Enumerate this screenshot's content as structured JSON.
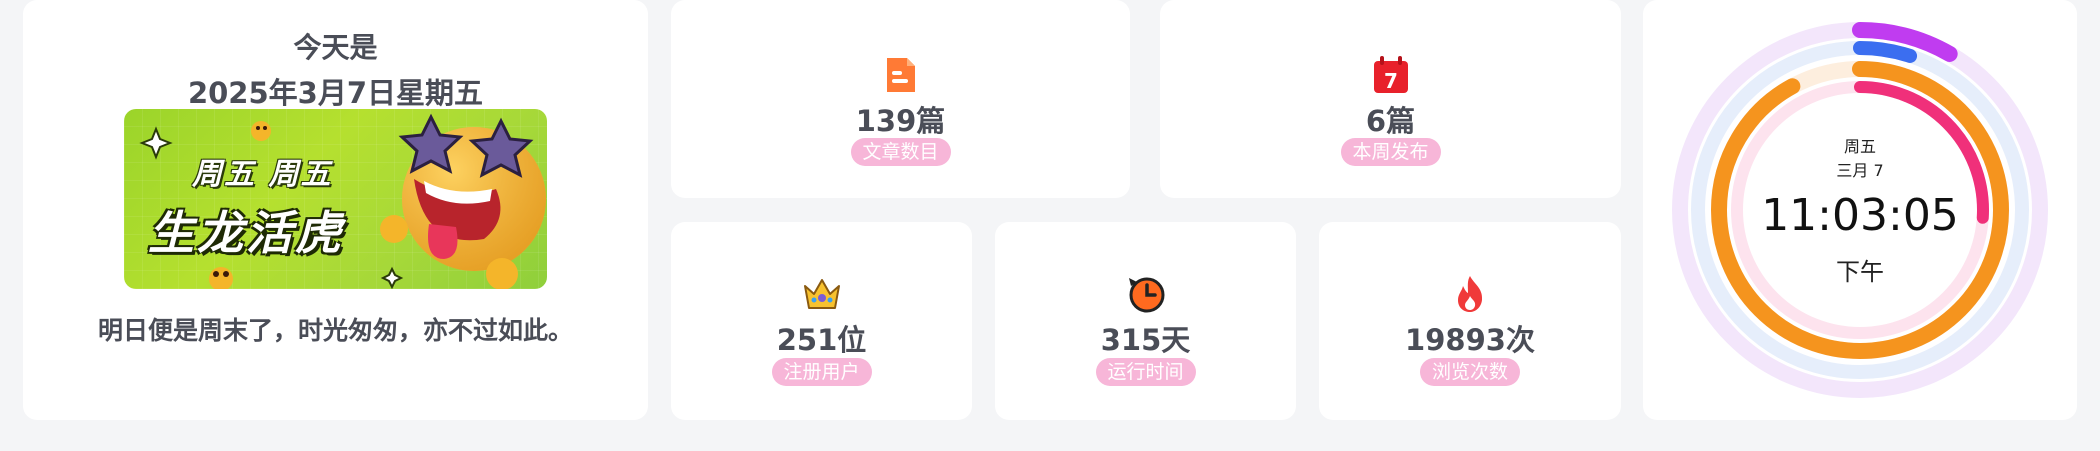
{
  "greeting": {
    "today_label": "今天是",
    "date": "2025年3月7日星期五",
    "banner_line1": "周五 周五",
    "banner_line2": "生龙活虎",
    "quote": "明日便是周末了，时光匆匆，亦不过如此。"
  },
  "stats": {
    "articles": {
      "value": "139篇",
      "label": "文章数目",
      "icon": "document-icon"
    },
    "week": {
      "value": "6篇",
      "label": "本周发布",
      "icon": "calendar-icon",
      "icon_text": "7"
    },
    "users": {
      "value": "251位",
      "label": "注册用户",
      "icon": "crown-icon"
    },
    "runtime": {
      "value": "315天",
      "label": "运行时间",
      "icon": "clock-history-icon"
    },
    "views": {
      "value": "19893次",
      "label": "浏览次数",
      "icon": "fire-icon"
    }
  },
  "clock": {
    "weekday": "周五",
    "date": "三月 7",
    "time": "11:03:05",
    "ampm": "下午",
    "rings": [
      {
        "name": "seconds",
        "fraction": 0.083,
        "color": "#c03cf0"
      },
      {
        "name": "minutes",
        "fraction": 0.05,
        "color": "#3b6ef0"
      },
      {
        "name": "hours",
        "fraction": 0.92,
        "color": "#f5941e"
      },
      {
        "name": "day",
        "fraction": 0.26,
        "color": "#f0307a"
      }
    ]
  },
  "colors": {
    "accent_pink": "#f7b6d8",
    "text": "#4a4d57",
    "banner_green": "#a6d839"
  }
}
